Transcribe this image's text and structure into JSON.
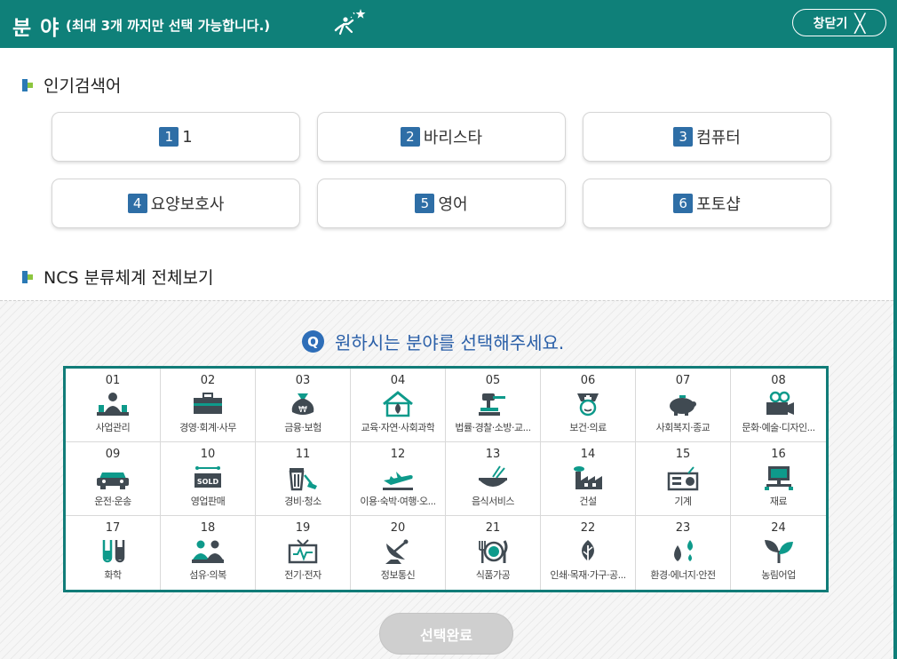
{
  "header": {
    "title": "분 야",
    "subtitle": "(최대 3개 까지만 선택 가능합니다.)",
    "close_label": "창닫기"
  },
  "popular": {
    "title": "인기검색어",
    "keywords": [
      {
        "rank": "1",
        "label": "1"
      },
      {
        "rank": "2",
        "label": "바리스타"
      },
      {
        "rank": "3",
        "label": "컴퓨터"
      },
      {
        "rank": "4",
        "label": "요양보호사"
      },
      {
        "rank": "5",
        "label": "영어"
      },
      {
        "rank": "6",
        "label": "포토샵"
      }
    ]
  },
  "ncs": {
    "title": "NCS 분류체계 전체보기",
    "prompt_badge": "Q",
    "prompt": "원하시는 분야를 선택해주세요.",
    "categories": [
      {
        "num": "01",
        "label": "사업관리",
        "icon": "meeting-icon"
      },
      {
        "num": "02",
        "label": "경영·회계·사무",
        "icon": "briefcase-icon"
      },
      {
        "num": "03",
        "label": "금융·보험",
        "icon": "money-bag-icon"
      },
      {
        "num": "04",
        "label": "교육·자연·사회과학",
        "icon": "house-leaf-icon"
      },
      {
        "num": "05",
        "label": "법률·경찰·소방·교...",
        "icon": "gavel-icon"
      },
      {
        "num": "06",
        "label": "보건·의료",
        "icon": "nurse-icon"
      },
      {
        "num": "07",
        "label": "사회복지·종교",
        "icon": "piggy-bank-icon"
      },
      {
        "num": "08",
        "label": "문화·예술·디자인...",
        "icon": "film-camera-icon"
      },
      {
        "num": "09",
        "label": "운전·운송",
        "icon": "car-icon"
      },
      {
        "num": "10",
        "label": "영업판매",
        "icon": "sold-sign-icon"
      },
      {
        "num": "11",
        "label": "경비·청소",
        "icon": "trash-broom-icon"
      },
      {
        "num": "12",
        "label": "이용·숙박·여행·오...",
        "icon": "airplane-icon"
      },
      {
        "num": "13",
        "label": "음식서비스",
        "icon": "bowl-icon"
      },
      {
        "num": "14",
        "label": "건설",
        "icon": "factory-icon"
      },
      {
        "num": "15",
        "label": "기계",
        "icon": "radio-machine-icon"
      },
      {
        "num": "16",
        "label": "재료",
        "icon": "computer-network-icon"
      },
      {
        "num": "17",
        "label": "화학",
        "icon": "test-tubes-icon"
      },
      {
        "num": "18",
        "label": "섬유·의복",
        "icon": "people-clothing-icon"
      },
      {
        "num": "19",
        "label": "전기·전자",
        "icon": "tv-icon"
      },
      {
        "num": "20",
        "label": "정보통신",
        "icon": "satellite-dish-icon"
      },
      {
        "num": "21",
        "label": "식품가공",
        "icon": "plate-fork-knife-icon"
      },
      {
        "num": "22",
        "label": "인쇄·목재·가구·공...",
        "icon": "leaf-icon"
      },
      {
        "num": "23",
        "label": "환경·에너지·안전",
        "icon": "water-drops-icon"
      },
      {
        "num": "24",
        "label": "농림어업",
        "icon": "sprout-icon"
      }
    ]
  },
  "submit_label": "선택완료",
  "colors": {
    "header": "#0f8079",
    "table_border": "#117c78",
    "rank_badge": "#2e6ea6",
    "icon": "#404a52",
    "icon_accent": "#0e9a8b",
    "prompt": "#2a5fa8"
  }
}
